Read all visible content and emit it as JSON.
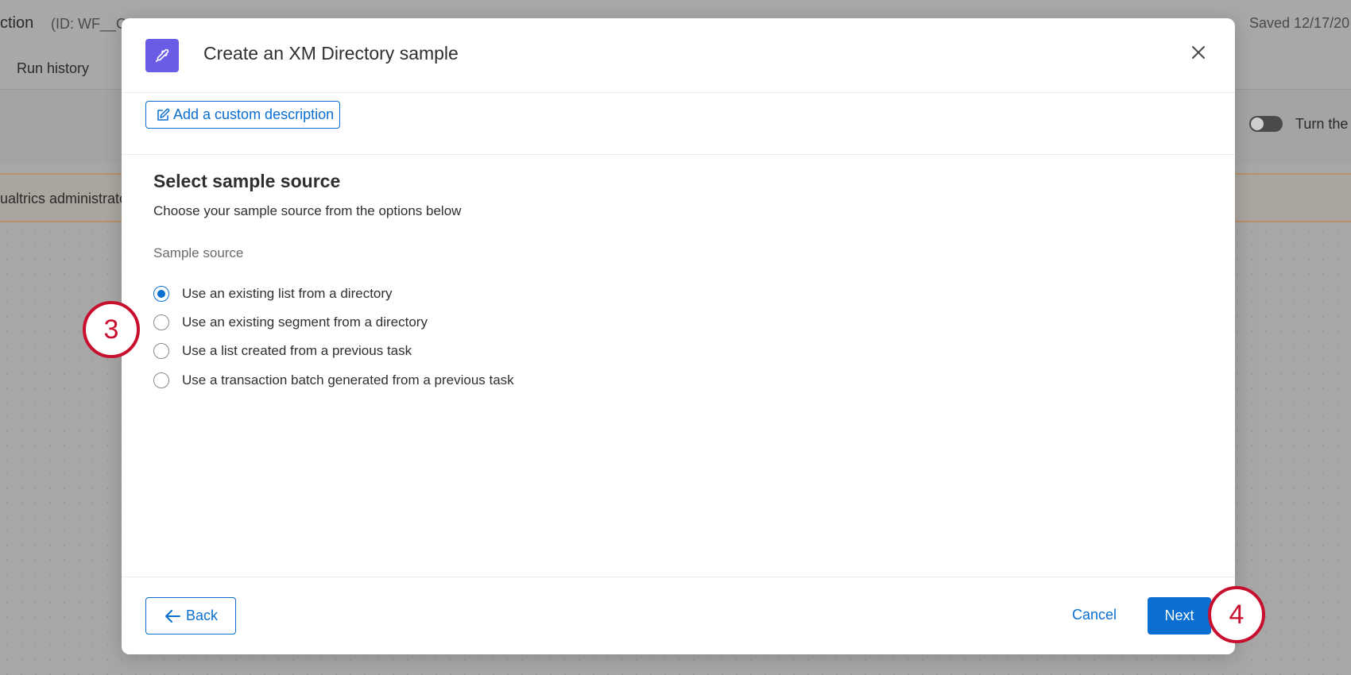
{
  "background": {
    "title_fragment": "ction",
    "id_fragment": "(ID: WF__C",
    "saved_fragment": "Saved 12/17/20",
    "tab_label": "Run history",
    "toggle_label": "Turn the",
    "banner_fragment": "ualtrics administrato"
  },
  "modal": {
    "title": "Create an XM Directory sample",
    "icon": "eyedropper-icon",
    "add_description_label": "Add a custom description",
    "section_title": "Select sample source",
    "section_subtitle": "Choose your sample source from the options below",
    "field_label": "Sample source",
    "options": [
      {
        "label": "Use an existing list from a directory",
        "selected": true
      },
      {
        "label": "Use an existing segment from a directory",
        "selected": false
      },
      {
        "label": "Use a list created from a previous task",
        "selected": false
      },
      {
        "label": "Use a transaction batch generated from a previous task",
        "selected": false
      }
    ],
    "footer": {
      "back_label": "Back",
      "cancel_label": "Cancel",
      "next_label": "Next"
    }
  },
  "callouts": {
    "step_3": "3",
    "step_4": "4"
  },
  "colors": {
    "accent": "#0b6ed1",
    "header_icon_bg": "#6b5ce6",
    "callout": "#c8102e",
    "overlay": "#a7a7a7"
  }
}
